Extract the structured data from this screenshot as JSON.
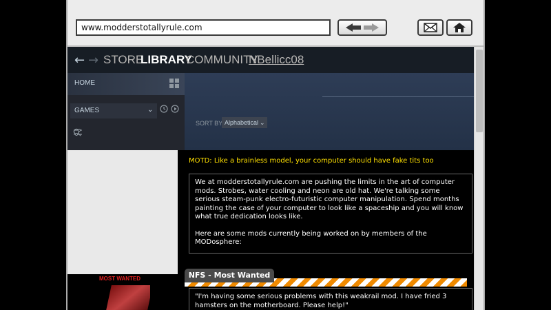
{
  "browser": {
    "url": "www.modderstotallyrule.com"
  },
  "steam": {
    "nav": [
      "STORE",
      "LIBRARY",
      "COMMUNITY",
      "NBellicc08"
    ],
    "home_label": "HOME",
    "games_label": "GAMES",
    "sort_by_label": "SORT BY",
    "sort_value": "Alphabetical"
  },
  "content": {
    "motd": "MOTD: Like a brainless model, your computer should have fake tits too",
    "intro_p1": "We at modderstotallyrule.com are pushing the limits in the art of computer mods.  Strobes, water cooling and neon are old hat.  We're talking some serious steam-punk electro-futuristic computer manipulation.  Spend months painting the case of your computer to look like a spaceship and you will know what true dedication looks like.",
    "intro_p2": "Here are some mods currently being worked on by members of the MODosphere:",
    "tab_label": "NFS - Most Wanted",
    "quote": "\"I'm having some serious problems with this weakrail mod.  I have fried 3 hamsters on the motherboard. Please help!\"",
    "thumb_title": "MOST WANTED"
  },
  "colors": {
    "motd": "#ffe000",
    "steam_bg": "#1b2838",
    "hazard_orange": "#f08a00"
  }
}
